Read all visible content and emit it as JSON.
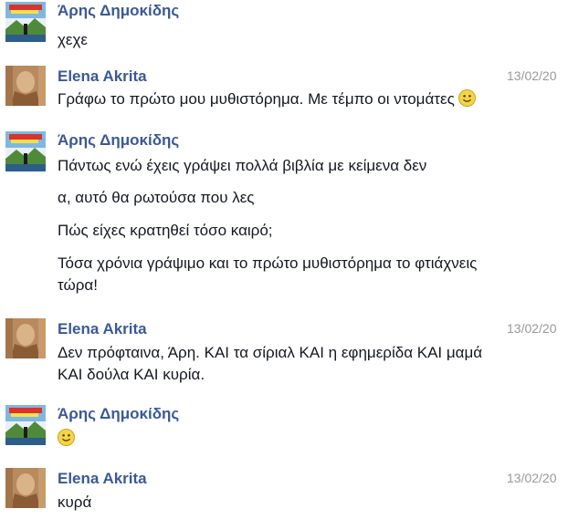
{
  "conversation": {
    "messages": [
      {
        "sender": "Άρης Δημοκίδης",
        "avatar_icon": "landscape-avatar",
        "timestamp": "",
        "lines": [
          "χεχε"
        ]
      },
      {
        "sender": "Elena Akrita",
        "avatar_icon": "portrait-avatar",
        "timestamp": "13/02/20",
        "lines": [
          "Γράφω το πρώτο μου μυθιστόρημα. Με τέμπο οι ντομάτες"
        ],
        "emoji": "smile-emoji"
      },
      {
        "sender": "Άρης Δημοκίδης",
        "avatar_icon": "landscape-avatar",
        "timestamp": "",
        "lines": [
          "Πάντως ενώ έχεις γράψει πολλά βιβλία με κείμενα δεν",
          "α, αυτό θα ρωτούσα που λες",
          "Πώς είχες κρατηθεί τόσο καιρό;",
          "Τόσα χρόνια γράψιμο και το πρώτο μυθιστόρημα το φτιάχνεις",
          "τώρα!"
        ]
      },
      {
        "sender": "Elena Akrita",
        "avatar_icon": "portrait-avatar",
        "timestamp": "13/02/20",
        "lines": [
          "Δεν πρόφταινα, Άρη. ΚΑΙ τα σίριαλ ΚΑΙ η εφημερίδα ΚΑΙ μαμά",
          "ΚΑΙ δούλα ΚΑΙ κυρία."
        ]
      },
      {
        "sender": "Άρης Δημοκίδης",
        "avatar_icon": "landscape-avatar",
        "timestamp": "",
        "lines": [],
        "emoji": "smile-emoji"
      },
      {
        "sender": "Elena Akrita",
        "avatar_icon": "portrait-avatar",
        "timestamp": "13/02/20",
        "lines": [
          "κυρά"
        ]
      }
    ]
  },
  "colors": {
    "sender_name": "#3b5998",
    "message_text": "#141823",
    "timestamp": "#999999",
    "smiley_fill": "#f5d547"
  }
}
